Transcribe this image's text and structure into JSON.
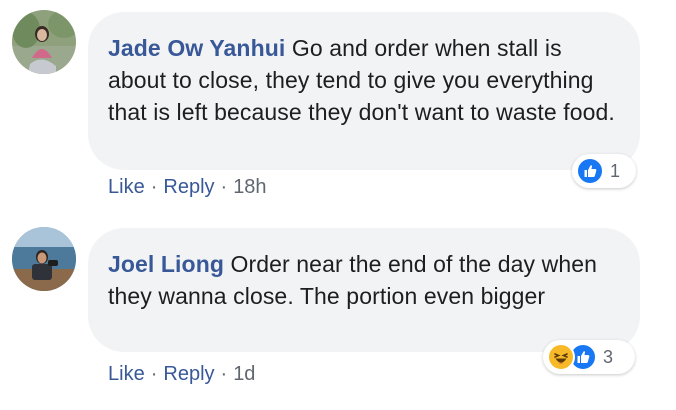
{
  "comments": [
    {
      "author": "Jade Ow Yanhui",
      "text": "Go and order when stall is about to close, they tend to give you everything that is left because they don't want to waste food.",
      "reactions": {
        "icons": [
          "like-icon"
        ],
        "count": "1"
      },
      "actions": {
        "like": "Like",
        "reply": "Reply",
        "separator": "·",
        "time": "18h"
      },
      "avatar_icon": "profile-photo"
    },
    {
      "author": "Joel Liong",
      "text": "Order near the end of the day when they wanna close. The portion even bigger",
      "reactions": {
        "icons": [
          "haha-icon",
          "like-icon"
        ],
        "count": "3"
      },
      "actions": {
        "like": "Like",
        "reply": "Reply",
        "separator": "·",
        "time": "1d"
      },
      "avatar_icon": "profile-photo"
    }
  ],
  "colors": {
    "author": "#385898",
    "bubble": "#f2f3f5",
    "text": "#1c1e21",
    "meta": "#606770",
    "like_blue": "#1877f2",
    "haha_yellow": "#f7b928"
  }
}
